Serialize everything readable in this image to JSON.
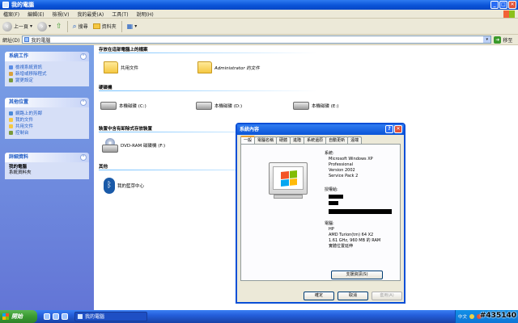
{
  "window": {
    "title": "我的電腦"
  },
  "menu": [
    "檔案(F)",
    "編輯(E)",
    "檢視(V)",
    "我的最愛(A)",
    "工具(T)",
    "說明(H)"
  ],
  "toolbar": {
    "back": "上一頁",
    "search": "搜尋",
    "folders": "資料夾"
  },
  "address": {
    "label": "網址(D)",
    "value": "我的電腦",
    "go": "移至"
  },
  "sidebar": {
    "system_tasks": {
      "title": "系統工作",
      "items": [
        "檢視系統資訊",
        "新增或移除程式",
        "變更設定"
      ]
    },
    "other_places": {
      "title": "其他位置",
      "items": [
        "網路上的芳鄰",
        "我的文件",
        "共用文件",
        "控制台"
      ]
    },
    "details": {
      "title": "詳細資料",
      "name": "我的電腦",
      "desc": "系統資料夾"
    }
  },
  "content": {
    "group_files": "存放在這部電腦上的檔案",
    "shared_docs": "共用文件",
    "admin_docs": "Administrator 的文件",
    "group_hdd": "硬碟機",
    "disks": [
      "本機磁碟 (C:)",
      "本機磁碟 (D:)",
      "本機磁碟 (E:)"
    ],
    "group_removable": "裝置中含有卸除式存放裝置",
    "dvd": "DVD-RAM 磁碟機 (F:)",
    "group_other": "其他",
    "bluetooth": "我的藍芽中心"
  },
  "dialog": {
    "title": "系統內容",
    "tabs": [
      "一般",
      "電腦名稱",
      "硬體",
      "進階",
      "系統還原",
      "自動更新",
      "遠端"
    ],
    "system_label": "系統:",
    "system_lines": [
      "Microsoft Windows XP",
      "Professional",
      "Version 2002",
      "Service Pack 2"
    ],
    "registered_label": "授權給:",
    "computer_label": "電腦:",
    "computer_lines": [
      "HP",
      "AMD Turion(tm) 64 X2",
      "1.61 GHz, 960 MB 的 RAM",
      "實體位置延伸"
    ],
    "support_button": "支援資訊(S)",
    "ok": "確定",
    "cancel": "取消",
    "apply": "套用(A)"
  },
  "taskbar": {
    "start": "開始",
    "task": "我的電腦",
    "tray_text": "中文"
  },
  "watermark": "#435140",
  "colors": {
    "xp_blue": "#0a54d8",
    "sidebar": "#6f8ce0",
    "start_green": "#3a9a32"
  }
}
